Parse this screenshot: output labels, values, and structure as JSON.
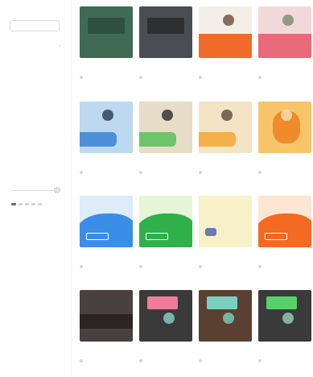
{
  "sidebar": {
    "top_label": "",
    "button_label": "",
    "sections": [
      {
        "heading": "",
        "items": [
          "",
          ""
        ]
      },
      {
        "heading": "",
        "items": [
          "",
          "",
          "",
          "",
          ""
        ]
      },
      {
        "heading": "",
        "items": [
          "",
          "",
          "",
          "",
          "",
          ""
        ]
      }
    ],
    "slider_min_label": "",
    "slider_max_label": ""
  },
  "cards": [
    {
      "title": "",
      "subtitle": "",
      "meta": "",
      "colors": {
        "bg": "#3f6a55",
        "band": "#2e4f42",
        "accent": "#cfd8c0"
      }
    },
    {
      "title": "",
      "subtitle": "",
      "meta": "",
      "colors": {
        "bg": "#4a4d52",
        "band": "#2d2f33",
        "accent": "#d9d9d9"
      }
    },
    {
      "title": "",
      "subtitle": "",
      "meta": "",
      "colors": {
        "bg": "#f4efe6",
        "band": "#f26a2a",
        "accent": "#6b4a3a"
      }
    },
    {
      "title": "",
      "subtitle": "",
      "meta": "",
      "colors": {
        "bg": "#f2d9d9",
        "band": "#e96a7a",
        "accent": "#7b8a6a"
      }
    },
    {
      "title": "",
      "subtitle": "",
      "meta": "",
      "colors": {
        "bg": "#bcd9f0",
        "band": "#4d8fd9",
        "accent": "#2b3a4a"
      }
    },
    {
      "title": "",
      "subtitle": "",
      "meta": "",
      "colors": {
        "bg": "#e7dcc8",
        "band": "#6dc46a",
        "accent": "#2a2a2a"
      }
    },
    {
      "title": "",
      "subtitle": "",
      "meta": "",
      "colors": {
        "bg": "#f3e4c6",
        "band": "#f5b04a",
        "accent": "#5a4a3a"
      }
    },
    {
      "title": "",
      "subtitle": "",
      "meta": "",
      "colors": {
        "bg": "#f8c46a",
        "band": "#f08a2a",
        "accent": "#f6e2b8"
      }
    },
    {
      "title": "",
      "subtitle": "",
      "meta": "",
      "colors": {
        "bg": "#dcecf8",
        "band": "#3a8ee8",
        "accent": "#ffffff"
      }
    },
    {
      "title": "",
      "subtitle": "",
      "meta": "",
      "colors": {
        "bg": "#e6f4d8",
        "band": "#2fb04a",
        "accent": "#ffffff"
      }
    },
    {
      "title": "",
      "subtitle": "",
      "meta": "",
      "colors": {
        "bg": "#f8f0c8",
        "band": "#6a7ab8",
        "accent": "#4a4a3a"
      }
    },
    {
      "title": "",
      "subtitle": "",
      "meta": "",
      "colors": {
        "bg": "#fde6d2",
        "band": "#f46a22",
        "accent": "#ffffff"
      }
    },
    {
      "title": "",
      "subtitle": "",
      "meta": "",
      "colors": {
        "bg": "#4a4040",
        "band": "#2a2424",
        "accent": "#8a7a6a"
      }
    },
    {
      "title": "",
      "subtitle": "",
      "meta": "",
      "colors": {
        "bg": "#3a3a3a",
        "band": "#f27a9a",
        "accent": "#8ad0c8"
      }
    },
    {
      "title": "",
      "subtitle": "",
      "meta": "",
      "colors": {
        "bg": "#5a4030",
        "band": "#3a2a20",
        "accent": "#7ad0c0"
      }
    },
    {
      "title": "",
      "subtitle": "",
      "meta": "",
      "colors": {
        "bg": "#3a3a3a",
        "band": "#5ad06a",
        "accent": "#9ad0b8"
      }
    }
  ]
}
